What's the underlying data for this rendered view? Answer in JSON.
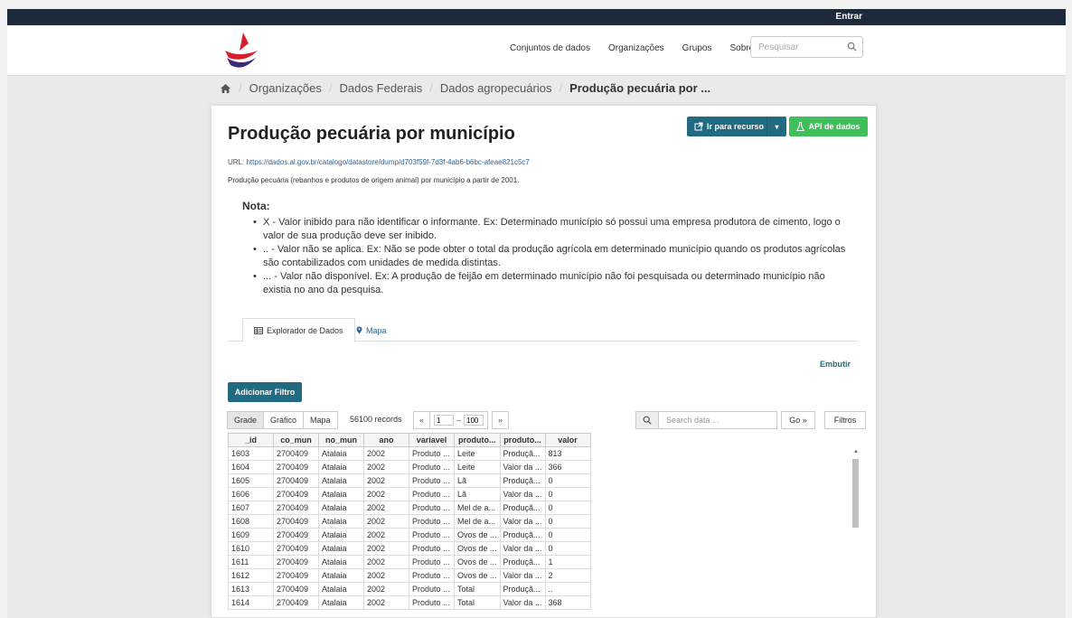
{
  "topbar": {
    "login": "Entrar"
  },
  "nav": {
    "links": [
      "Conjuntos de dados",
      "Organizações",
      "Grupos",
      "Sobre"
    ],
    "search_placeholder": "Pesquisar"
  },
  "breadcrumb": [
    "Organizações",
    "Dados Federais",
    "Dados agropecuários",
    "Produção pecuária por ..."
  ],
  "resource": {
    "title": "Produção pecuária por município",
    "btn_resource": "Ir para recurso",
    "btn_api": "API de dados",
    "url_label": "URL: ",
    "url": "https://dados.al.gov.br/catalogo/datastore/dump/d703f59f-7d3f-4ab6-b6bc-afeae821c5c7",
    "description": "Produção pecuária (rebanhos e produtos de origem animal) por município a partir de 2001."
  },
  "nota": {
    "heading": "Nota:",
    "items": [
      "X - Valor inibido para não identificar o informante. Ex: Determinado município só possui uma empresa produtora de cimento, logo o valor de sua produção deve ser inibido.",
      ".. - Valor não se aplica. Ex: Não se pode obter o total da produção agrícola em determinado município quando os produtos agrícolas são contabilizados com unidades de medida distintas.",
      "... - Valor não disponível. Ex: A produção de feijão em determinado município não foi pesquisada ou determinado município não existia no ano da pesquisa."
    ]
  },
  "tabs": {
    "explorer": "Explorador de Dados",
    "map": "Mapa"
  },
  "explorer": {
    "embed": "Embutir",
    "add_filter": "Adicionar Filtro",
    "views": [
      "Grade",
      "Gráfico",
      "Mapa"
    ],
    "records": "56100 records",
    "pager": {
      "prev": "«",
      "from": "1",
      "dash": "–",
      "to": "100",
      "next": "»"
    },
    "search_placeholder": "Search data ...",
    "go": "Go »",
    "filters": "Filtros"
  },
  "table": {
    "columns": [
      "_id",
      "co_mun",
      "no_mun",
      "ano",
      "variavel",
      "produto...",
      "produto...",
      "valor"
    ],
    "rows": [
      [
        "1603",
        "2700409",
        "Atalaia",
        "2002",
        "Produto ...",
        "Leite",
        "Produçã...",
        "813"
      ],
      [
        "1604",
        "2700409",
        "Atalaia",
        "2002",
        "Produto ...",
        "Leite",
        "Valor da ...",
        "366"
      ],
      [
        "1605",
        "2700409",
        "Atalaia",
        "2002",
        "Produto ...",
        "Lã",
        "Produçã...",
        "0"
      ],
      [
        "1606",
        "2700409",
        "Atalaia",
        "2002",
        "Produto ...",
        "Lã",
        "Valor da ...",
        "0"
      ],
      [
        "1607",
        "2700409",
        "Atalaia",
        "2002",
        "Produto ...",
        "Mel de a...",
        "Produçã...",
        "0"
      ],
      [
        "1608",
        "2700409",
        "Atalaia",
        "2002",
        "Produto ...",
        "Mel de a...",
        "Valor da ...",
        "0"
      ],
      [
        "1609",
        "2700409",
        "Atalaia",
        "2002",
        "Produto ...",
        "Ovos de ...",
        "Produçã...",
        "0"
      ],
      [
        "1610",
        "2700409",
        "Atalaia",
        "2002",
        "Produto ...",
        "Ovos de ...",
        "Valor da ...",
        "0"
      ],
      [
        "1611",
        "2700409",
        "Atalaia",
        "2002",
        "Produto ...",
        "Ovos de ...",
        "Produçã...",
        "1"
      ],
      [
        "1612",
        "2700409",
        "Atalaia",
        "2002",
        "Produto ...",
        "Ovos de ...",
        "Valor da ...",
        "2"
      ],
      [
        "1613",
        "2700409",
        "Atalaia",
        "2002",
        "Produto ...",
        "Total",
        "Produçã...",
        ".."
      ],
      [
        "1614",
        "2700409",
        "Atalaia",
        "2002",
        "Produto ...",
        "Total",
        "Valor da ...",
        "368"
      ]
    ]
  },
  "colors": {
    "navy": "#1e2a3a",
    "teal": "#206b82",
    "green": "#3fbf5a",
    "link": "#2a6496"
  },
  "icons": [
    "home-icon",
    "search-icon",
    "external-link-icon",
    "flask-icon",
    "table-icon",
    "map-marker-icon",
    "caret-down-icon",
    "logo-icon"
  ]
}
